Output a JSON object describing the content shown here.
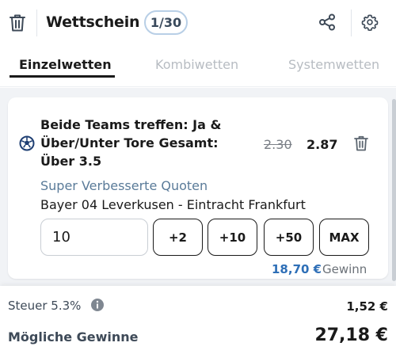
{
  "header": {
    "title": "Wettschein",
    "count": "1/30",
    "icons": [
      "trash-icon",
      "share-icon",
      "gear-icon"
    ]
  },
  "tabs": [
    {
      "label": "Einzelwetten",
      "active": true
    },
    {
      "label": "Kombiwetten",
      "active": false
    },
    {
      "label": "Systemwetten",
      "active": false
    }
  ],
  "bet": {
    "sport_icon": "football-icon",
    "market": "Beide Teams treffen: Ja & Über/Unter Tore Gesamt: Über 3.5",
    "old_odds": "2.30",
    "new_odds": "2.87",
    "promo": "Super Verbesserte Quoten",
    "match": "Bayer 04 Leverkusen - Eintracht Frankfurt",
    "stake": "10",
    "quick_buttons": [
      "+2",
      "+10",
      "+50",
      "MAX"
    ],
    "winnings_amount": "18,70 €",
    "winnings_label": "Gewinn"
  },
  "summary": {
    "tax_label": "Steuer 5.3%",
    "tax_value": "1,52 €",
    "possible_win_label": "Mögliche Gewinne",
    "possible_win_value": "27,18 €"
  },
  "colors": {
    "accent_blue": "#2e6fb7",
    "promo_blue": "#5a7b99",
    "badge_border": "#b8cfe6",
    "background": "#f1f3f6"
  }
}
